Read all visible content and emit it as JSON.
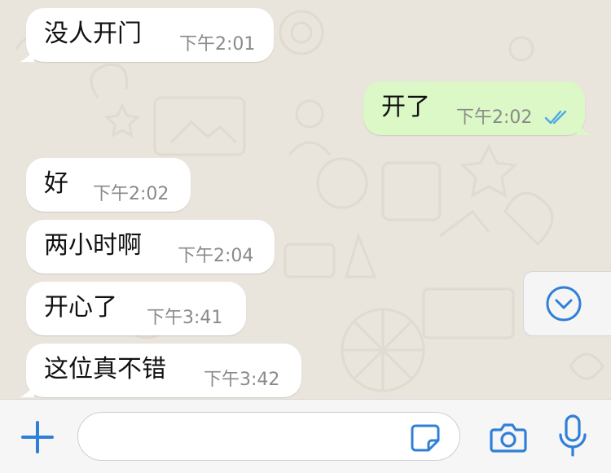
{
  "messages": [
    {
      "direction": "in",
      "text": "没人开门",
      "time": "下午2:01"
    },
    {
      "direction": "out",
      "text": "开了",
      "time": "下午2:02",
      "status": "read-double-check"
    },
    {
      "direction": "in",
      "text": "好",
      "time": "下午2:02"
    },
    {
      "direction": "in",
      "text": "两小时啊",
      "time": "下午2:04"
    },
    {
      "direction": "in",
      "text": "开心了",
      "time": "下午3:41"
    },
    {
      "direction": "in",
      "text": "这位真不错",
      "time": "下午3:42"
    }
  ],
  "composer": {
    "placeholder": "",
    "icons": [
      "plus-icon",
      "sticker-icon",
      "camera-icon",
      "microphone-icon"
    ]
  },
  "scroll_button_icon": "chevron-down-circle-icon",
  "colors": {
    "accent": "#2F7FD8",
    "incoming_bubble": "#FFFFFF",
    "outgoing_bubble": "#DCF8C6",
    "read_ticks": "#4FA8E6",
    "timestamp": "#8A8A8A",
    "chat_background": "#E9E4DC"
  }
}
